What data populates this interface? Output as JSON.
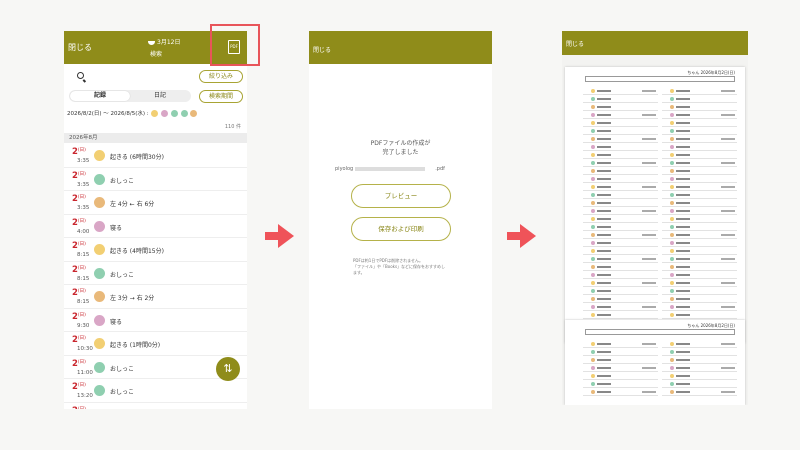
{
  "panel1": {
    "close_label": "閉じる",
    "date_label": "3月12日",
    "search_label": "検索",
    "pdf_label": "PDF",
    "filter_label": "絞り込み",
    "tabs": [
      {
        "label": "記録"
      },
      {
        "label": "日記"
      }
    ],
    "settings_label": "検索期間",
    "range_label": "2026/8/2(日) ～ 2026/8/5(水) :",
    "count_label": "110 件",
    "month_label": "2026年8月",
    "entries": [
      {
        "day": "2",
        "wd": "(日)",
        "time": "3:35",
        "icon": "wake",
        "label": "起きる (6時間30分)"
      },
      {
        "day": "2",
        "wd": "(日)",
        "time": "3:35",
        "icon": "pee",
        "label": "おしっこ"
      },
      {
        "day": "2",
        "wd": "(日)",
        "time": "3:35",
        "icon": "milk",
        "label": "左 4分 ← 右 6分"
      },
      {
        "day": "2",
        "wd": "(日)",
        "time": "4:00",
        "icon": "sleep",
        "label": "寝る"
      },
      {
        "day": "2",
        "wd": "(日)",
        "time": "8:15",
        "icon": "wake",
        "label": "起きる (4時間15分)"
      },
      {
        "day": "2",
        "wd": "(日)",
        "time": "8:15",
        "icon": "pee",
        "label": "おしっこ"
      },
      {
        "day": "2",
        "wd": "(日)",
        "time": "8:15",
        "icon": "milk",
        "label": "左 3分 → 右 2分"
      },
      {
        "day": "2",
        "wd": "(日)",
        "time": "9:30",
        "icon": "sleep",
        "label": "寝る"
      },
      {
        "day": "2",
        "wd": "(日)",
        "time": "10:30",
        "icon": "wake",
        "label": "起きる (1時間0分)"
      },
      {
        "day": "2",
        "wd": "(日)",
        "time": "11:00",
        "icon": "pee",
        "label": "おしっこ"
      },
      {
        "day": "2",
        "wd": "(日)",
        "time": "13:20",
        "icon": "pee",
        "label": "おしっこ"
      },
      {
        "day": "2",
        "wd": "(日)",
        "time": "",
        "icon": "",
        "label": ""
      }
    ]
  },
  "panel2": {
    "close_label": "閉じる",
    "done_line1": "PDFファイルの作成が",
    "done_line2": "完了しました",
    "file_prefix": "piyolog",
    "file_ext": ".pdf",
    "preview_label": "プレビュー",
    "save_label": "保存および印刷",
    "note_line1": "PDFは約1日でPDFは削除されません。",
    "note_line2": "「ファイル」や「Books」などに保存をおすすめし",
    "note_line3": "ます。"
  },
  "panel3": {
    "close_label": "閉じる",
    "doc_title": "ちゃん 2026年8月2日(日)"
  },
  "colors": {
    "header": "#8f8c1a",
    "accent_red": "#ef5359",
    "day_red": "#c9252d"
  }
}
